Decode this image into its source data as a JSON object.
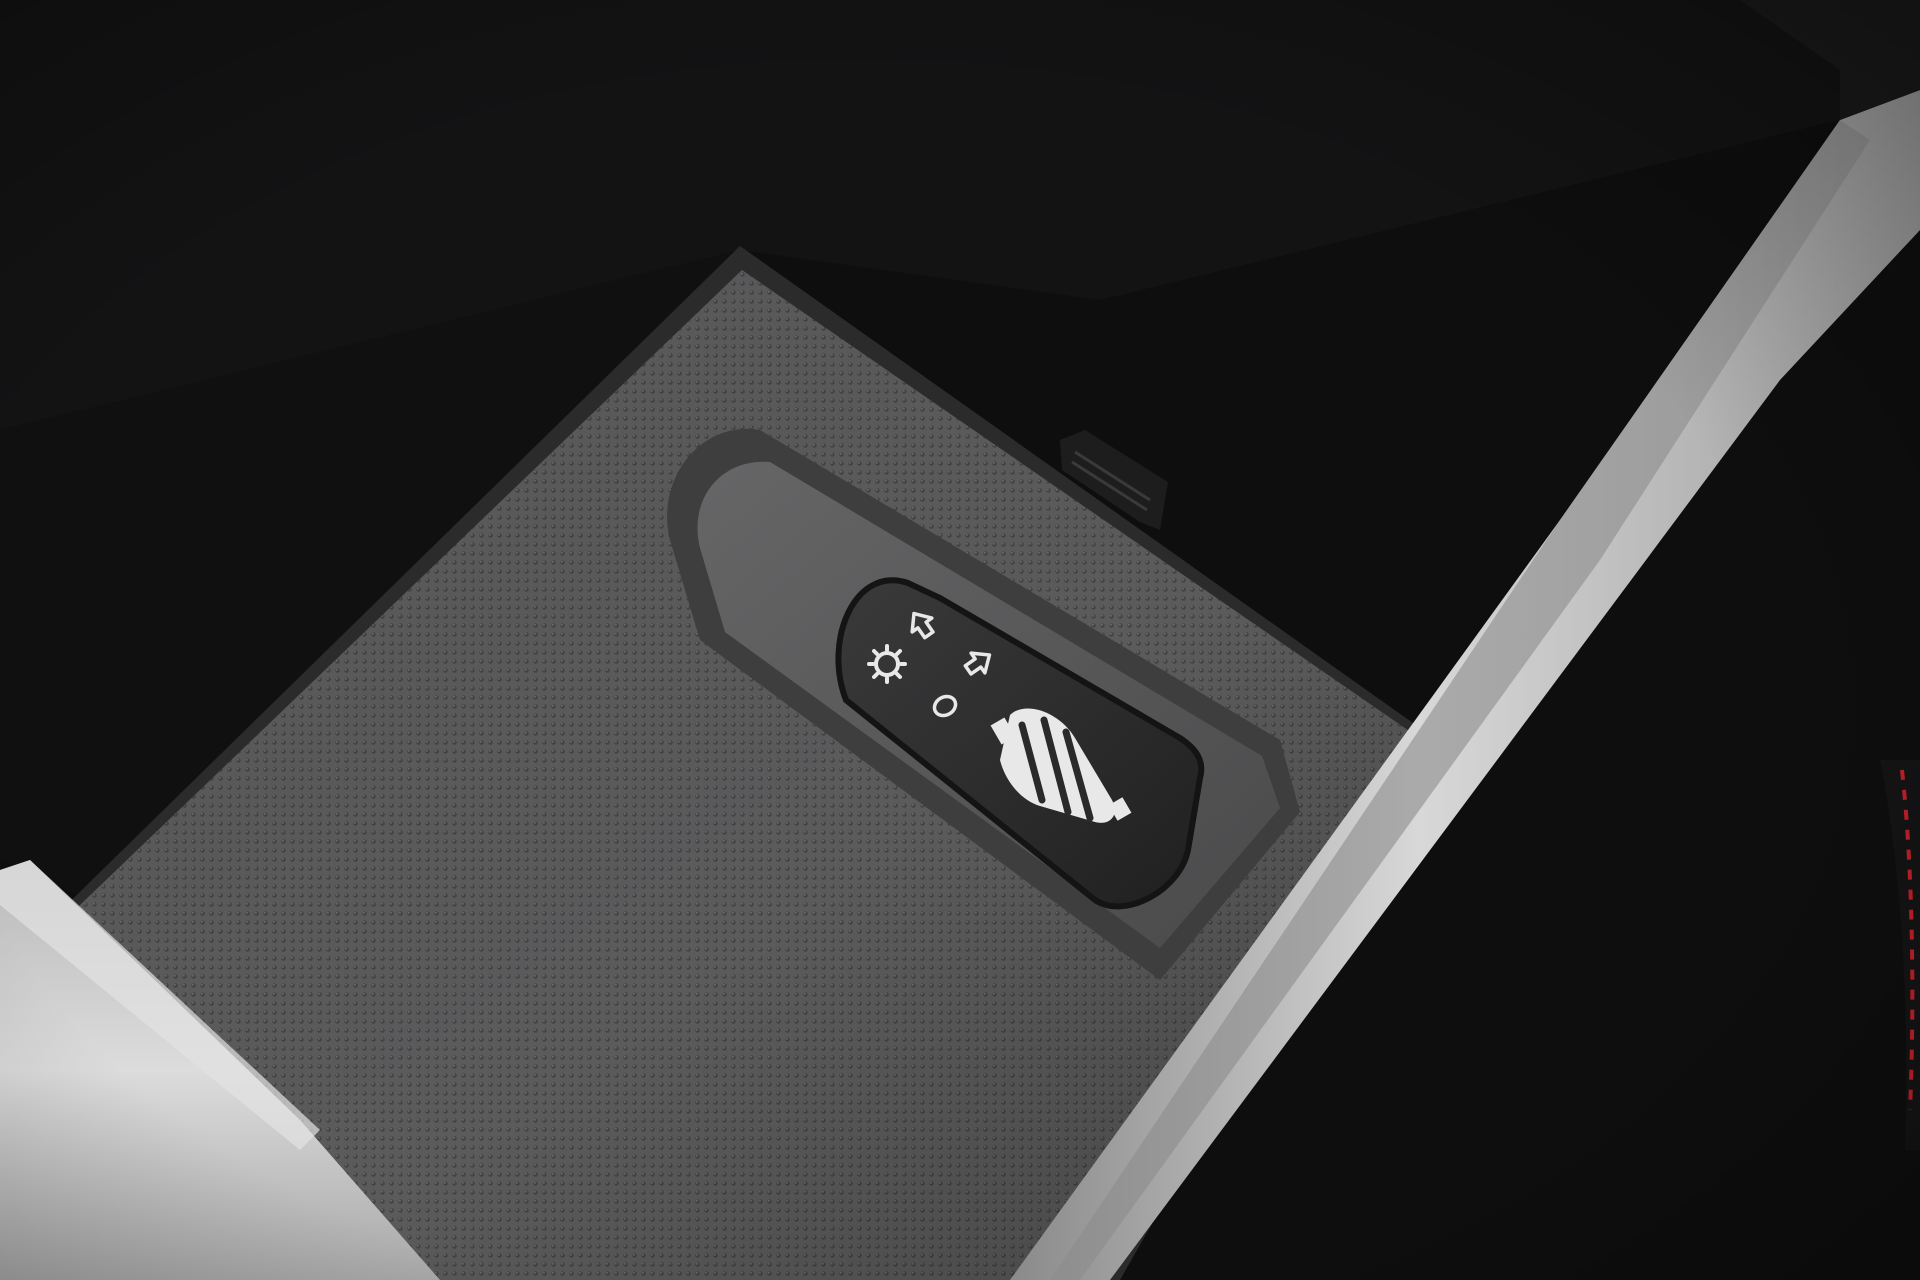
{
  "scene": {
    "subject": "center-console-storage-compartment",
    "colors": {
      "background": "#0b0b0c",
      "compartment_wall": "#151516",
      "storage_mat": "#5b5b5c",
      "mat_dot": "#474748",
      "mat_border": "#2a2a2b",
      "recess": "#545455",
      "switch_body": "#2c2c2d",
      "switch_symbols": "#e8e8e8",
      "trim_silver": "#c9c9c9",
      "stitching": "#c0202a"
    },
    "switch": {
      "icons": [
        "sun-gear-icon",
        "arrow-up-icon",
        "arrow-right-icon",
        "circle-off-icon",
        "driver-seat-icon"
      ]
    }
  }
}
